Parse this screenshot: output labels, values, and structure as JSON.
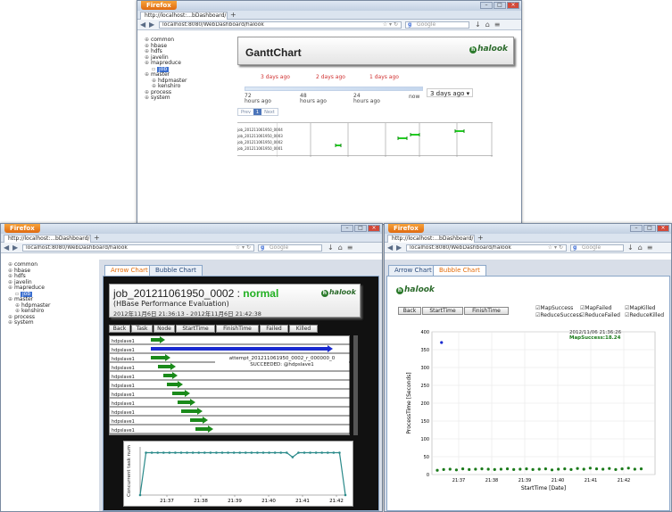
{
  "browser": {
    "menu_label": "Firefox",
    "tab_title": "http://localhost:...bDashboard/halook",
    "url": "localhost:8080/WebDashboard/halook",
    "search_placeholder": "Google",
    "new_tab": "+"
  },
  "tree": [
    {
      "label": "common",
      "indent": 0
    },
    {
      "label": "hbase",
      "indent": 0
    },
    {
      "label": "hdfs",
      "indent": 0
    },
    {
      "label": "javelin",
      "indent": 0
    },
    {
      "label": "mapreduce",
      "indent": 0
    },
    {
      "label": "job",
      "indent": 1,
      "selected": true
    },
    {
      "label": "master",
      "indent": 0
    },
    {
      "label": "hdpmaster",
      "indent": 1
    },
    {
      "label": "kenshiro",
      "indent": 1
    },
    {
      "label": "process",
      "indent": 0
    },
    {
      "label": "system",
      "indent": 0
    }
  ],
  "gantt": {
    "title": "GanttChart",
    "logo": "halook",
    "slider_ticks": [
      "3 days ago",
      "2 days ago",
      "1 days ago"
    ],
    "axis_labels": [
      "72\nhours ago",
      "48\nhours ago",
      "24\nhours ago",
      "now"
    ],
    "range_select": "3 days ago",
    "pager": [
      "Prev",
      "1",
      "Next"
    ],
    "job_labels": [
      "job_201211061950_0004",
      "job_201211061950_0003",
      "job_201211061950_0002",
      "job_201211061950_0001"
    ]
  },
  "arrow": {
    "tabs": [
      "Arrow Chart",
      "Bubble Chart"
    ],
    "job_id": "job_201211061950_0002",
    "separator": ":",
    "status": "normal",
    "subtitle": "(HBase Performance Evaluation)",
    "time_range": "2012年11月6日 21:36:13 - 2012年11月6日 21:42:38",
    "buttons": [
      "Back",
      "Task",
      "Node",
      "StartTime",
      "FinishTime",
      "Failed",
      "Killed"
    ],
    "hosts": [
      "hdpslave1",
      "hdpslave1",
      "hdpslave1",
      "hdpslave1",
      "hdpslave1",
      "hdpslave1",
      "hdpslave1",
      "hdpslave1",
      "hdpslave1",
      "hdpslave1",
      "hdpslave1"
    ],
    "tooltip_line1": "attempt_201211061950_0002_r_000000_0",
    "tooltip_line2": "SUCCEEDED:  @hdpslave1",
    "concurrent_ylabel": "Concurrent task num",
    "concurrent_x": [
      "21:37",
      "21:38",
      "21:39",
      "21:40",
      "21:41",
      "21:42"
    ],
    "colors": {
      "arrow": "#1a8a1a",
      "selected_arrow": "#1a2ad0",
      "status": "#22b022",
      "line": "#2a8a8a"
    }
  },
  "bubble": {
    "tabs": [
      "Arrow Chart",
      "Bubble Chart"
    ],
    "buttons": [
      "Back",
      "StartTime",
      "FinishTime"
    ],
    "legend": [
      "MapSuccess",
      "MapFailed",
      "MapKilled",
      "ReduceSuccess",
      "ReduceFailed",
      "ReduceKilled"
    ],
    "tooltip_time": "2012/11/06 21:36:26",
    "tooltip_value": "MapSuccess:18.24"
  },
  "chart_data": [
    {
      "type": "scatter",
      "title": "",
      "xlabel": "StartTime [Date]",
      "ylabel": "ProcessTime [Seconds]",
      "x_ticks": [
        "21:37",
        "21:38",
        "21:39",
        "21:40",
        "21:41",
        "21:42"
      ],
      "y_ticks": [
        0,
        50,
        100,
        150,
        200,
        250,
        300,
        350,
        400
      ],
      "ylim": [
        0,
        400
      ],
      "series": [
        {
          "name": "MapSuccess",
          "color": "#1a7a1a",
          "points": [
            [
              0.0,
              12
            ],
            [
              0.03,
              14
            ],
            [
              0.06,
              15
            ],
            [
              0.09,
              13
            ],
            [
              0.12,
              16
            ],
            [
              0.15,
              14
            ],
            [
              0.18,
              15
            ],
            [
              0.21,
              16
            ],
            [
              0.24,
              15
            ],
            [
              0.27,
              14
            ],
            [
              0.3,
              15
            ],
            [
              0.33,
              16
            ],
            [
              0.36,
              14
            ],
            [
              0.39,
              15
            ],
            [
              0.42,
              16
            ],
            [
              0.45,
              14
            ],
            [
              0.48,
              15
            ],
            [
              0.51,
              16
            ],
            [
              0.54,
              13
            ],
            [
              0.57,
              15
            ],
            [
              0.6,
              16
            ],
            [
              0.63,
              14
            ],
            [
              0.66,
              17
            ],
            [
              0.69,
              15
            ],
            [
              0.72,
              18
            ],
            [
              0.75,
              16
            ],
            [
              0.78,
              15
            ],
            [
              0.81,
              17
            ],
            [
              0.84,
              14
            ],
            [
              0.87,
              16
            ],
            [
              0.9,
              18
            ],
            [
              0.93,
              15
            ],
            [
              0.96,
              16
            ]
          ]
        },
        {
          "name": "ReduceSuccess",
          "color": "#1a2ad0",
          "points": [
            [
              0.02,
              370
            ]
          ]
        }
      ]
    },
    {
      "type": "line",
      "title": "",
      "xlabel": "",
      "ylabel": "Concurrent task num",
      "x_ticks": [
        "21:37",
        "21:38",
        "21:39",
        "21:40",
        "21:41",
        "21:42"
      ],
      "values": [
        0,
        95,
        95,
        95,
        95,
        95,
        95,
        95,
        95,
        95,
        95,
        95,
        95,
        95,
        95,
        95,
        95,
        95,
        95,
        95,
        95,
        95,
        95,
        95,
        95,
        95,
        85,
        95,
        95,
        95,
        95,
        95,
        95,
        95,
        95,
        0
      ],
      "ylim": [
        0,
        100
      ]
    }
  ]
}
